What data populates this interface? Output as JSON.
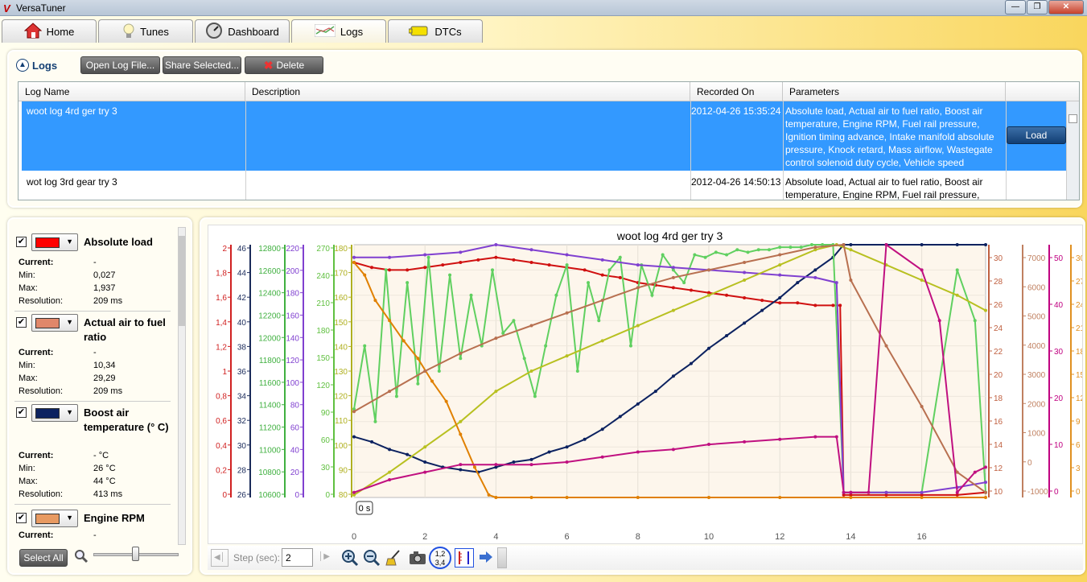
{
  "window": {
    "title": "VersaTuner"
  },
  "tabs": [
    {
      "label": "Home",
      "icon": "home-icon"
    },
    {
      "label": "Tunes",
      "icon": "bulb-icon"
    },
    {
      "label": "Dashboard",
      "icon": "gauge-icon"
    },
    {
      "label": "Logs",
      "icon": "chart-icon"
    },
    {
      "label": "DTCs",
      "icon": "engine-icon"
    }
  ],
  "logs": {
    "title": "Logs",
    "open_label": "Open Log File...",
    "share_label": "Share Selected...",
    "delete_label": "Delete",
    "columns": [
      "Log Name",
      "Description",
      "Recorded On",
      "Parameters"
    ],
    "rows": [
      {
        "name": "woot log 4rd ger try 3",
        "description": "",
        "recorded": "2012-04-26 15:35:24",
        "params": [
          "Absolute load, Actual air to fuel ratio, Boost air",
          "temperature, Engine RPM, Fuel rail pressure,",
          "Ignition timing advance, Intake manifold absolute",
          "pressure, Knock retard, Mass airflow, Wastegate",
          "control solenoid duty cycle, Vehicle speed"
        ],
        "action": "Load"
      },
      {
        "name": "wot log 3rd gear try 3",
        "description": "",
        "recorded": "2012-04-26 14:50:13",
        "params": [
          "Absolute load, Actual air to fuel ratio, Boost air",
          "temperature, Engine RPM, Fuel rail pressure,"
        ]
      }
    ]
  },
  "parameters": {
    "labels": {
      "current": "Current:",
      "min": "Min:",
      "max": "Max:",
      "res": "Resolution:"
    },
    "items": [
      {
        "name": "Absolute load",
        "color": "#ff0000",
        "current": "-",
        "min": "0,027",
        "max": "1,937",
        "res": "209 ms"
      },
      {
        "name": "Actual air to fuel ratio",
        "color": "#e0876a",
        "current": "-",
        "min": "10,34",
        "max": "29,29",
        "res": "209 ms"
      },
      {
        "name": "Boost air temperature (° C)",
        "color": "#0c2260",
        "current": "- °C",
        "min": "26 °C",
        "max": "44 °C",
        "res": "413 ms"
      },
      {
        "name": "Engine RPM",
        "color": "#e89a62",
        "current": "-"
      }
    ],
    "select_all_label": "Select All"
  },
  "toolbar": {
    "step_label": "Step (sec):",
    "step_value": "2",
    "layout_badge": "1,2\n3,4"
  },
  "chart_data": {
    "type": "line",
    "title": "woot log 4rd ger try 3",
    "cursor_label": "0 s",
    "xlim": [
      0,
      17.8
    ],
    "x_ticks": [
      0,
      2,
      4,
      6,
      8,
      10,
      12,
      14,
      16
    ],
    "left_axes": [
      {
        "color": "#d02020",
        "ticks": [
          "2",
          "1,8",
          "1,6",
          "1,4",
          "1,2",
          "1",
          "0,8",
          "0,6",
          "0,4",
          "0,2",
          "0"
        ]
      },
      {
        "color": "#1a2a5a",
        "ticks": [
          "46",
          "44",
          "42",
          "40",
          "38",
          "36",
          "34",
          "32",
          "30",
          "28",
          "26"
        ]
      },
      {
        "color": "#40b040",
        "ticks": [
          "12800",
          "12600",
          "12400",
          "12200",
          "12000",
          "11800",
          "11600",
          "11400",
          "11200",
          "11000",
          "10800",
          "10600"
        ]
      },
      {
        "color": "#8040d0",
        "ticks": [
          "220",
          "200",
          "180",
          "160",
          "140",
          "120",
          "100",
          "80",
          "60",
          "40",
          "20",
          "0"
        ]
      },
      {
        "color": "#60c040",
        "ticks": [
          "270",
          "240",
          "210",
          "180",
          "150",
          "120",
          "90",
          "60",
          "30",
          "0"
        ]
      },
      {
        "color": "#b0b020",
        "ticks": [
          "180",
          "170",
          "160",
          "150",
          "140",
          "130",
          "120",
          "110",
          "100",
          "90",
          "80"
        ]
      }
    ],
    "right_axes": [
      {
        "color": "#c06040",
        "ticks": [
          "30",
          "28",
          "26",
          "24",
          "22",
          "20",
          "18",
          "16",
          "14",
          "12",
          "10"
        ]
      },
      {
        "color": "#c08060",
        "ticks": [
          "7000",
          "6000",
          "5000",
          "4000",
          "3000",
          "2000",
          "1000",
          "0",
          "-1000"
        ]
      },
      {
        "color": "#c00080",
        "ticks": [
          "50",
          "40",
          "30",
          "20",
          "10",
          "0"
        ]
      },
      {
        "color": "#e09020",
        "ticks": [
          "30",
          "27",
          "24",
          "21",
          "18",
          "15",
          "12",
          "9",
          "6",
          "3",
          "0"
        ]
      }
    ],
    "series": [
      {
        "color": "#d01010",
        "x": [
          0,
          0.5,
          1,
          1.5,
          2,
          2.5,
          3,
          3.5,
          4,
          4.5,
          5,
          5.5,
          6,
          6.5,
          7,
          7.5,
          8,
          8.5,
          9,
          9.5,
          10,
          10.5,
          11,
          11.5,
          12,
          12.5,
          13,
          13.5,
          13.7,
          13.8,
          14,
          15,
          16,
          17,
          17.8
        ],
        "y": [
          0.93,
          0.91,
          0.9,
          0.9,
          0.91,
          0.92,
          0.93,
          0.94,
          0.95,
          0.94,
          0.93,
          0.92,
          0.91,
          0.9,
          0.88,
          0.87,
          0.85,
          0.84,
          0.83,
          0.82,
          0.81,
          0.8,
          0.79,
          0.78,
          0.77,
          0.77,
          0.76,
          0.76,
          0.76,
          0.01,
          0.01,
          0.01,
          0.01,
          0.01,
          0.02
        ]
      },
      {
        "color": "#0c2260",
        "x": [
          0,
          0.5,
          1,
          1.5,
          2,
          2.5,
          3,
          3.5,
          4,
          4.5,
          5,
          5.5,
          6,
          6.5,
          7,
          7.5,
          8,
          8.5,
          9,
          9.5,
          10,
          10.5,
          11,
          11.5,
          12,
          12.5,
          13,
          13.5,
          13.8,
          14,
          15,
          16,
          17,
          17.8
        ],
        "y": [
          0.24,
          0.22,
          0.19,
          0.17,
          0.14,
          0.12,
          0.11,
          0.1,
          0.12,
          0.14,
          0.15,
          0.18,
          0.2,
          0.23,
          0.27,
          0.32,
          0.37,
          0.42,
          0.48,
          0.53,
          0.59,
          0.64,
          0.69,
          0.74,
          0.79,
          0.85,
          0.9,
          0.95,
          1,
          1,
          1,
          1,
          1,
          1
        ]
      },
      {
        "color": "#60d060",
        "x": [
          0,
          0.3,
          0.6,
          0.9,
          1.2,
          1.5,
          1.8,
          2.1,
          2.4,
          2.7,
          3,
          3.3,
          3.6,
          3.9,
          4.2,
          4.5,
          4.8,
          5.1,
          5.4,
          5.7,
          6,
          6.3,
          6.6,
          6.9,
          7.2,
          7.5,
          7.8,
          8.1,
          8.4,
          8.7,
          9,
          9.3,
          9.6,
          9.9,
          10.2,
          10.5,
          10.8,
          11.1,
          11.4,
          11.7,
          12,
          12.3,
          12.6,
          12.9,
          13.2,
          13.5,
          13.8,
          14,
          15,
          16,
          17,
          17.5,
          17.8
        ],
        "y": [
          0.35,
          0.6,
          0.3,
          0.9,
          0.4,
          0.85,
          0.45,
          0.95,
          0.5,
          0.88,
          0.55,
          0.8,
          0.6,
          0.9,
          0.65,
          0.7,
          0.55,
          0.4,
          0.6,
          0.8,
          0.92,
          0.5,
          0.85,
          0.7,
          0.9,
          0.95,
          0.6,
          0.92,
          0.8,
          0.96,
          0.9,
          0.85,
          0.96,
          0.95,
          0.97,
          0.96,
          0.98,
          0.97,
          0.98,
          0.98,
          0.99,
          0.99,
          0.99,
          1,
          1,
          1,
          0.02,
          0.02,
          0.02,
          0.02,
          0.9,
          0.7,
          0.02
        ]
      },
      {
        "color": "#8040d0",
        "x": [
          0,
          1,
          2,
          3,
          4,
          5,
          6,
          7,
          8,
          9,
          10,
          11,
          12,
          13,
          13.6,
          13.8,
          14,
          15,
          16,
          17,
          17.8
        ],
        "y": [
          0.95,
          0.95,
          0.96,
          0.97,
          1,
          0.98,
          0.96,
          0.94,
          0.92,
          0.91,
          0.9,
          0.89,
          0.88,
          0.87,
          0.85,
          0.02,
          0.02,
          0.02,
          0.02,
          0.04,
          0.06
        ]
      },
      {
        "color": "#b8c020",
        "x": [
          0,
          1,
          2,
          3,
          4,
          5,
          6,
          7,
          8,
          9,
          10,
          11,
          12,
          13,
          13.6,
          14,
          15,
          16,
          17,
          17.8
        ],
        "y": [
          0.01,
          0.1,
          0.2,
          0.3,
          0.42,
          0.5,
          0.56,
          0.62,
          0.68,
          0.74,
          0.8,
          0.86,
          0.92,
          0.98,
          1,
          0.98,
          0.92,
          0.86,
          0.8,
          0.74
        ]
      },
      {
        "color": "#e08000",
        "x": [
          0,
          0.3,
          0.6,
          1,
          1.4,
          1.8,
          2.2,
          2.6,
          3,
          3.4,
          3.8,
          4,
          5,
          6,
          8,
          10,
          12,
          14,
          16,
          17.8
        ],
        "y": [
          0.93,
          0.88,
          0.78,
          0.7,
          0.62,
          0.55,
          0.46,
          0.38,
          0.25,
          0.12,
          0.01,
          0.0,
          0.0,
          0.0,
          0.0,
          0.0,
          0.0,
          0.0,
          0.0,
          0.0
        ]
      },
      {
        "color": "#b87050",
        "x": [
          0,
          1,
          2,
          3,
          4,
          5,
          6,
          7,
          8,
          9,
          10,
          11,
          12,
          13,
          13.8,
          14,
          15,
          16,
          17,
          17.8
        ],
        "y": [
          0.34,
          0.42,
          0.5,
          0.57,
          0.63,
          0.68,
          0.73,
          0.78,
          0.83,
          0.87,
          0.9,
          0.93,
          0.96,
          0.99,
          1,
          0.86,
          0.6,
          0.36,
          0.1,
          0.02
        ]
      },
      {
        "color": "#c01080",
        "x": [
          0,
          1,
          2,
          3,
          4,
          5,
          6,
          7,
          8,
          9,
          10,
          11,
          12,
          13,
          13.6,
          13.8,
          14,
          14.5,
          15,
          16,
          16.5,
          17,
          17.5,
          17.8
        ],
        "y": [
          0.02,
          0.07,
          0.1,
          0.13,
          0.13,
          0.13,
          0.14,
          0.16,
          0.18,
          0.19,
          0.21,
          0.22,
          0.23,
          0.24,
          0.24,
          0.02,
          0.02,
          0.02,
          1,
          0.9,
          0.7,
          0.02,
          0.1,
          0.12
        ]
      }
    ]
  }
}
